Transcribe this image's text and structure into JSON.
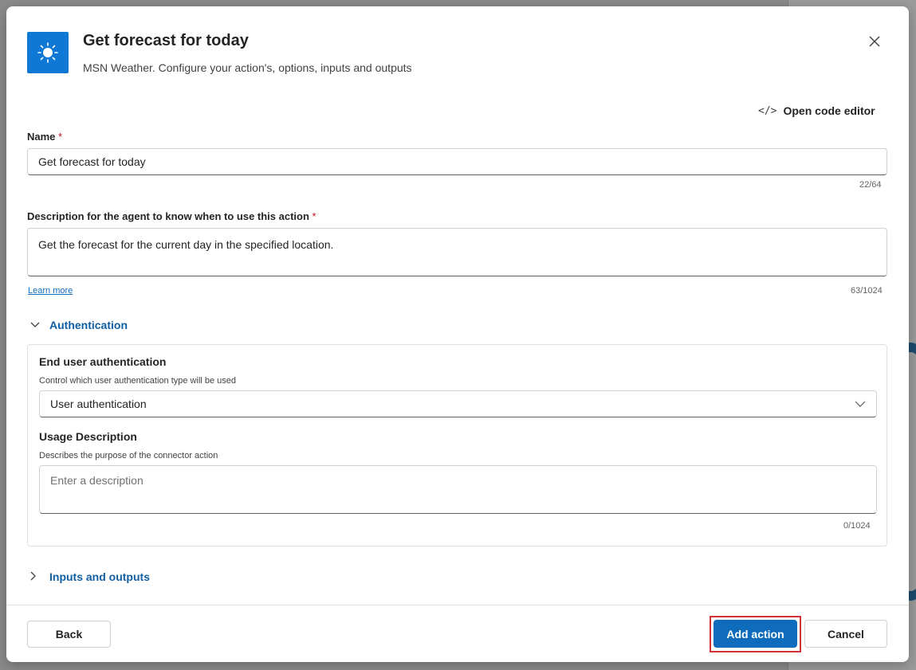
{
  "header": {
    "title": "Get forecast for today",
    "subtitle": "MSN Weather. Configure your action's, options, inputs and outputs",
    "icon": "sun-icon",
    "accent_color": "#0f78d4"
  },
  "toolbar": {
    "code_editor_label": "Open code editor"
  },
  "name_field": {
    "label": "Name",
    "required_mark": "*",
    "value": "Get forecast for today",
    "counter": "22/64"
  },
  "description_field": {
    "label": "Description for the agent to know when to use this action",
    "required_mark": "*",
    "value": "Get the forecast for the current day in the specified location.",
    "counter": "63/1024",
    "learn_more": "Learn more"
  },
  "authentication": {
    "section_label": "Authentication",
    "expanded": true,
    "end_user": {
      "heading": "End user authentication",
      "hint": "Control which user authentication type will be used",
      "selected": "User authentication"
    },
    "usage": {
      "heading": "Usage Description",
      "hint": "Describes the purpose of the connector action",
      "placeholder": "Enter a description",
      "counter": "0/1024"
    }
  },
  "inputs_outputs": {
    "section_label": "Inputs and outputs",
    "expanded": false
  },
  "footer": {
    "back_label": "Back",
    "add_label": "Add action",
    "cancel_label": "Cancel"
  },
  "colors": {
    "primary": "#0f6cbd",
    "link": "#115ea3",
    "required": "#c50f1f",
    "highlight": "#d13438"
  }
}
